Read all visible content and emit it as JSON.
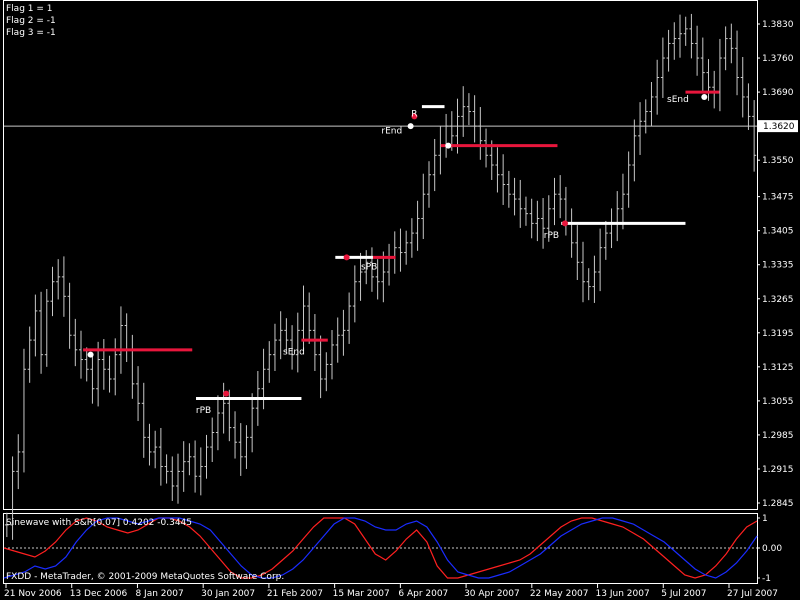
{
  "flags": [
    "Flag 1 = 1",
    "Flag 2 = -1",
    "Flag 3 = -1"
  ],
  "indicator": {
    "title": "Sinewave with S&R[0.07] 0.4202 -0.3445",
    "copyright": "FXDD - MetaTrader, © 2001-2009 MetaQuotes Software Corp."
  },
  "colors": {
    "background": "#000000",
    "frame": "#ffffff",
    "bars": "#c8c8c8",
    "resistance": "#e8163c",
    "support": "#ffffff",
    "sine": "#ff2020",
    "leadsine": "#1a2cff"
  },
  "chart_data": [
    {
      "type": "ohlc",
      "y_ticks": [
        "1.3830",
        "1.3760",
        "1.3690",
        "1.3620",
        "1.3550",
        "1.3475",
        "1.3405",
        "1.3335",
        "1.3265",
        "1.3195",
        "1.3125",
        "1.3055",
        "1.2985",
        "1.2915",
        "1.2845"
      ],
      "current_price": "1.3620",
      "x_labels": [
        "21 Nov 2006",
        "13 Dec 2006",
        "8 Jan 2007",
        "30 Jan 2007",
        "21 Feb 2007",
        "15 Mar 2007",
        "6 Apr 2007",
        "30 Apr 2007",
        "22 May 2007",
        "13 Jun 2007",
        "5 Jul 2007",
        "27 Jul 2007"
      ],
      "close": [
        1.28,
        1.291,
        1.295,
        1.312,
        1.318,
        1.324,
        1.315,
        1.326,
        1.33,
        1.331,
        1.327,
        1.319,
        1.316,
        1.314,
        1.312,
        1.308,
        1.314,
        1.312,
        1.31,
        1.315,
        1.321,
        1.316,
        1.309,
        1.305,
        1.298,
        1.295,
        1.296,
        1.292,
        1.291,
        1.288,
        1.291,
        1.293,
        1.294,
        1.29,
        1.292,
        1.296,
        1.299,
        1.303,
        1.305,
        1.3,
        1.297,
        1.294,
        1.298,
        1.304,
        1.308,
        1.312,
        1.315,
        1.318,
        1.32,
        1.318,
        1.315,
        1.32,
        1.325,
        1.32,
        1.315,
        1.31,
        1.313,
        1.317,
        1.319,
        1.32,
        1.325,
        1.33,
        1.332,
        1.334,
        1.331,
        1.33,
        1.332,
        1.335,
        1.337,
        1.336,
        1.338,
        1.34,
        1.343,
        1.348,
        1.352,
        1.356,
        1.358,
        1.362,
        1.36,
        1.364,
        1.366,
        1.365,
        1.362,
        1.359,
        1.356,
        1.354,
        1.352,
        1.35,
        1.348,
        1.347,
        1.345,
        1.344,
        1.342,
        1.343,
        1.341,
        1.345,
        1.348,
        1.347,
        1.342,
        1.338,
        1.334,
        1.33,
        1.329,
        1.332,
        1.337,
        1.34,
        1.342,
        1.345,
        1.348,
        1.354,
        1.36,
        1.363,
        1.365,
        1.368,
        1.372,
        1.376,
        1.379,
        1.38,
        1.381,
        1.382,
        1.379,
        1.376,
        1.373,
        1.37,
        1.369,
        1.376,
        1.38,
        1.378,
        1.372,
        1.368,
        1.364,
        1.356
      ],
      "resistance_segments": [
        {
          "x0": 0.105,
          "x1": 0.25,
          "y": 1.316
        },
        {
          "x0": 0.395,
          "x1": 0.43,
          "y": 1.318
        },
        {
          "x0": 0.49,
          "x1": 0.52,
          "y": 1.335
        },
        {
          "x0": 0.58,
          "x1": 0.735,
          "y": 1.358
        },
        {
          "x0": 0.905,
          "x1": 0.95,
          "y": 1.369
        }
      ],
      "support_segments": [
        {
          "x0": 0.255,
          "x1": 0.395,
          "y": 1.306
        },
        {
          "x0": 0.44,
          "x1": 0.49,
          "y": 1.335
        },
        {
          "x0": 0.555,
          "x1": 0.585,
          "y": 1.366
        },
        {
          "x0": 0.74,
          "x1": 0.905,
          "y": 1.342
        }
      ],
      "dots": [
        {
          "x": 0.115,
          "y": 1.315,
          "color": "#ffffff"
        },
        {
          "x": 0.295,
          "y": 1.307,
          "color": "#e8163c"
        },
        {
          "x": 0.455,
          "y": 1.335,
          "color": "#e8163c"
        },
        {
          "x": 0.54,
          "y": 1.362,
          "color": "#ffffff"
        },
        {
          "x": 0.545,
          "y": 1.364,
          "color": "#e8163c"
        },
        {
          "x": 0.59,
          "y": 1.358,
          "color": "#ffffff"
        },
        {
          "x": 0.745,
          "y": 1.342,
          "color": "#e8163c"
        },
        {
          "x": 0.93,
          "y": 1.368,
          "color": "#ffffff"
        }
      ],
      "signals": [
        {
          "label": "rPB",
          "x": 0.265,
          "y": 1.303
        },
        {
          "label": "sEnd",
          "x": 0.385,
          "y": 1.315
        },
        {
          "label": "sPB",
          "x": 0.485,
          "y": 1.3325
        },
        {
          "label": "rEnd",
          "x": 0.515,
          "y": 1.3605
        },
        {
          "label": "R",
          "x": 0.545,
          "y": 1.364
        },
        {
          "label": "rPB",
          "x": 0.727,
          "y": 1.339
        },
        {
          "label": "sEnd",
          "x": 0.895,
          "y": 1.367
        }
      ]
    },
    {
      "type": "line",
      "y_ticks": [
        "1",
        "0.00",
        "-1"
      ],
      "ylim": [
        -1,
        1
      ],
      "series": [
        {
          "values": [
            0.0,
            -0.1,
            -0.2,
            -0.3,
            -0.1,
            0.2,
            0.6,
            0.9,
            1.0,
            0.9,
            0.7,
            0.6,
            0.5,
            0.6,
            0.8,
            1.0,
            1.0,
            0.9,
            0.7,
            0.4,
            0.0,
            -0.4,
            -0.8,
            -1.0,
            -1.0,
            -0.9,
            -0.7,
            -0.4,
            -0.1,
            0.3,
            0.7,
            1.0,
            1.0,
            1.0,
            0.8,
            0.3,
            -0.2,
            -0.4,
            -0.1,
            0.3,
            0.6,
            0.2,
            -0.6,
            -1.0,
            -1.0,
            -0.9,
            -0.8,
            -0.7,
            -0.6,
            -0.5,
            -0.4,
            -0.2,
            0.1,
            0.4,
            0.7,
            0.9,
            1.0,
            1.0,
            0.9,
            0.8,
            0.7,
            0.5,
            0.3,
            0.0,
            -0.3,
            -0.6,
            -0.9,
            -1.0,
            -0.9,
            -0.6,
            -0.2,
            0.3,
            0.7,
            0.9
          ]
        },
        {
          "values": [
            -1.0,
            -0.9,
            -0.8,
            -0.6,
            -0.7,
            -0.6,
            -0.3,
            0.2,
            0.6,
            0.9,
            1.0,
            1.0,
            0.9,
            0.8,
            0.9,
            1.0,
            1.0,
            1.0,
            0.9,
            0.8,
            0.6,
            0.2,
            -0.2,
            -0.6,
            -0.9,
            -1.0,
            -1.0,
            -0.9,
            -0.7,
            -0.4,
            0.0,
            0.4,
            0.8,
            1.0,
            1.0,
            0.9,
            0.7,
            0.6,
            0.6,
            0.8,
            0.9,
            0.7,
            0.2,
            -0.4,
            -0.8,
            -0.9,
            -1.0,
            -1.0,
            -0.9,
            -0.8,
            -0.6,
            -0.4,
            -0.2,
            0.1,
            0.4,
            0.6,
            0.8,
            0.9,
            1.0,
            1.0,
            0.9,
            0.8,
            0.6,
            0.4,
            0.2,
            -0.1,
            -0.4,
            -0.7,
            -0.9,
            -1.0,
            -0.8,
            -0.5,
            -0.1,
            0.4
          ]
        }
      ]
    }
  ]
}
